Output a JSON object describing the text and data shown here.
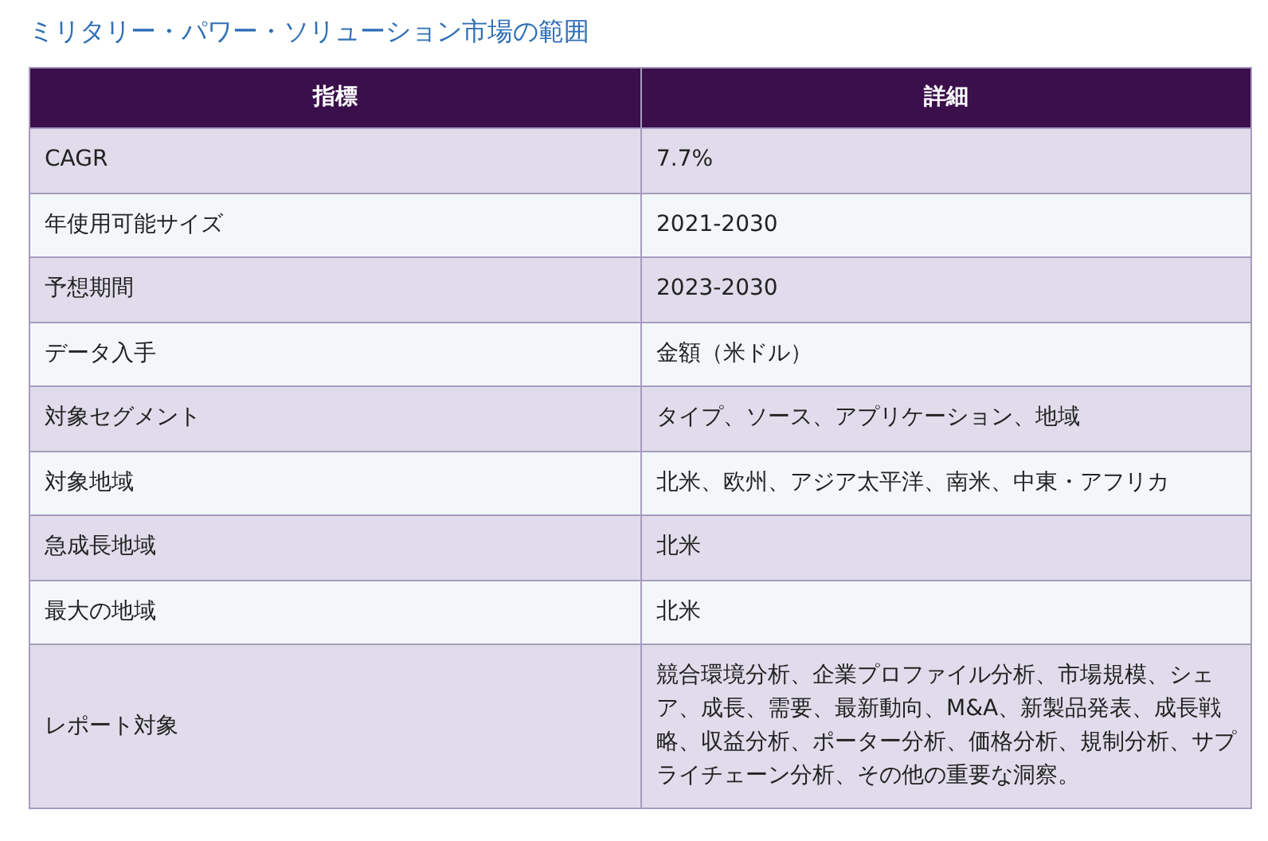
{
  "title": "ミリタリー・パワー・ソリューション市場の範囲",
  "table": {
    "columns": [
      "指標",
      "詳細"
    ],
    "rows": [
      {
        "metric": "CAGR",
        "detail": "7.7%"
      },
      {
        "metric": "年使用可能サイズ",
        "detail": "2021-2030"
      },
      {
        "metric": "予想期間",
        "detail": "2023-2030"
      },
      {
        "metric": "データ入手",
        "detail": "金額（米ドル）"
      },
      {
        "metric": "対象セグメント",
        "detail": "タイプ、ソース、アプリケーション、地域"
      },
      {
        "metric": "対象地域",
        "detail": "北米、欧州、アジア太平洋、南米、中東・アフリカ"
      },
      {
        "metric": "急成長地域",
        "detail": "北米"
      },
      {
        "metric": "最大の地域",
        "detail": "北米"
      },
      {
        "metric": "レポート対象",
        "detail": "競合環境分析、企業プロファイル分析、市場規模、シェア、成長、需要、最新動向、M&A、新製品発表、成長戦略、収益分析、ポーター分析、価格分析、規制分析、サプライチェーン分析、その他の重要な洞察。"
      }
    ]
  }
}
